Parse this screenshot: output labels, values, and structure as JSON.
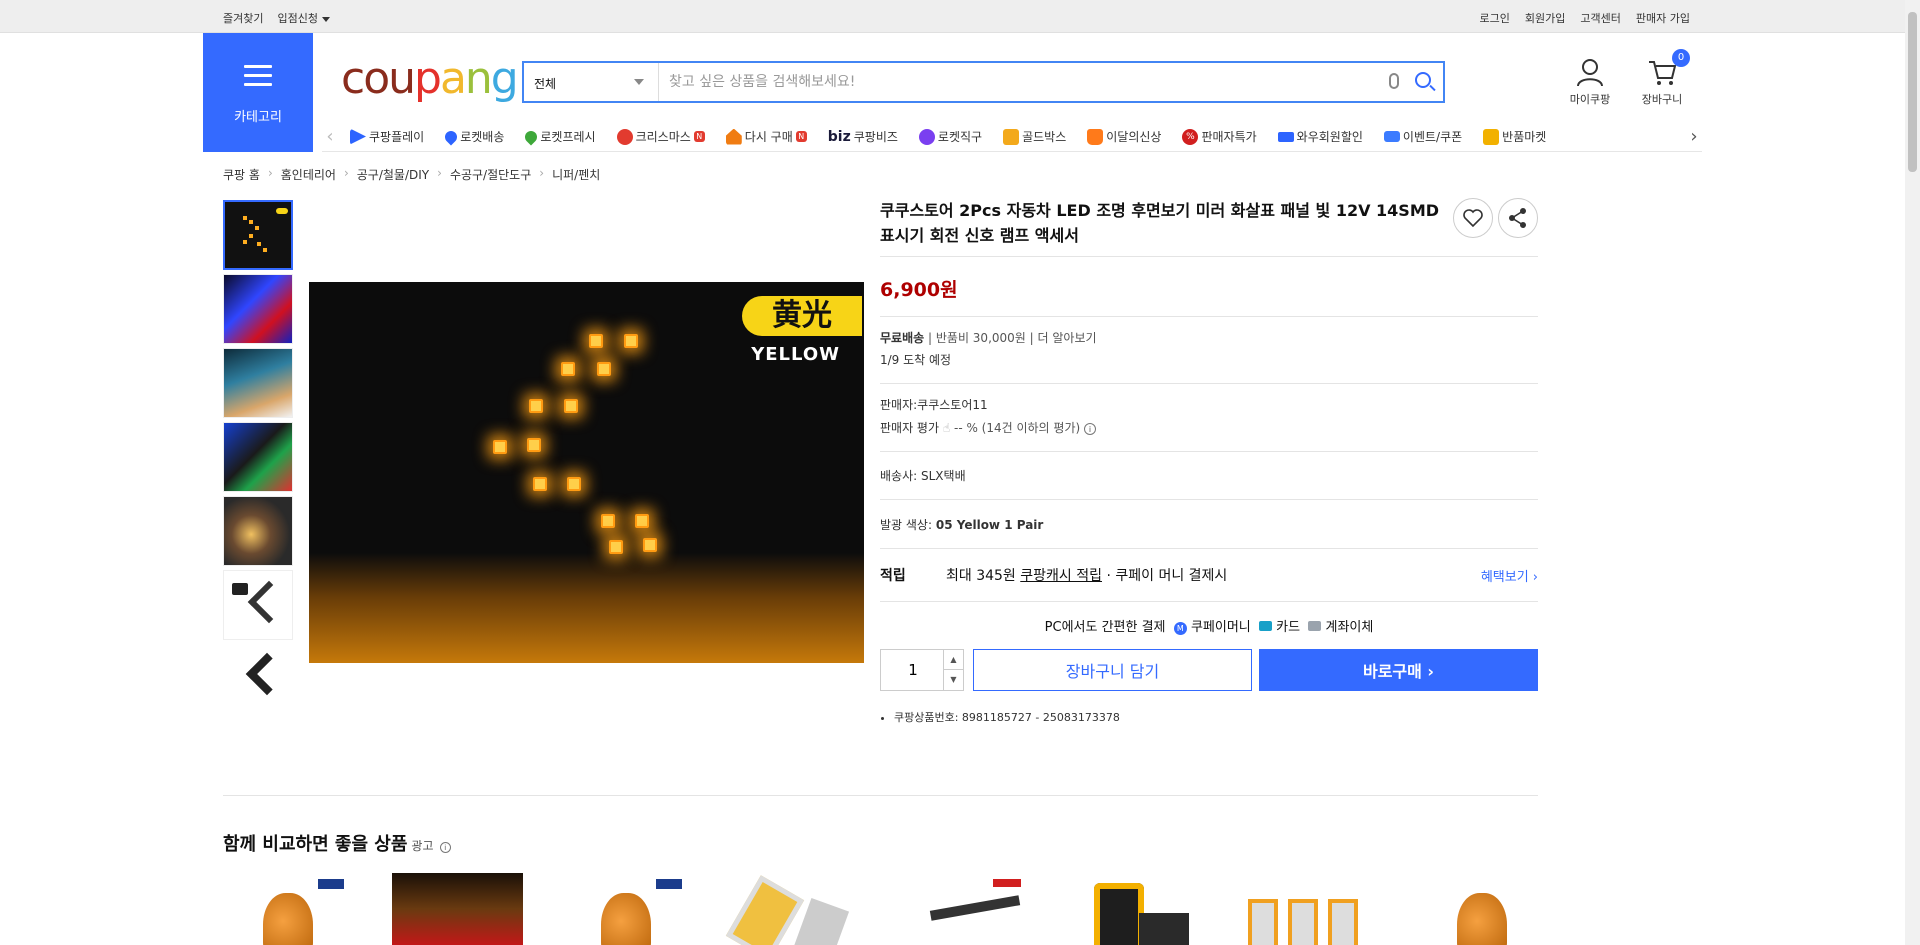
{
  "topbar": {
    "left": {
      "favorites": "즐겨찾기",
      "vendor_apply": "입점신청"
    },
    "right": [
      "로그인",
      "회원가입",
      "고객센터",
      "판매자 가입"
    ]
  },
  "header": {
    "category_label": "카테고리",
    "logo": {
      "c1": "cou",
      "c2": "p",
      "c3": "a",
      "c4": "n",
      "c5": "g"
    },
    "search": {
      "scope": "전체",
      "placeholder": "찾고 싶은 상품을 검색해보세요!"
    },
    "mycoupang": "마이쿠팡",
    "cart": "장바구니",
    "cart_count": "0"
  },
  "nav": {
    "items": [
      {
        "label": "쿠팡플레이",
        "icon": "play-icon",
        "color": "#2d64ff"
      },
      {
        "label": "로켓배송",
        "icon": "rocket-icon",
        "color": "#2d64ff"
      },
      {
        "label": "로켓프레시",
        "icon": "rocket-fresh-icon",
        "color": "#3ea83a"
      },
      {
        "label": "크리스마스",
        "icon": "santa-icon",
        "color": "#e23b2f"
      },
      {
        "label": "다시 구매",
        "icon": "home-icon",
        "color": "#f07c12"
      },
      {
        "label": "쿠팡비즈",
        "icon": "biz-icon",
        "color": "#1b1b3a",
        "prefix": "biz"
      },
      {
        "label": "로켓직구",
        "icon": "globe-icon",
        "color": "#7a3ff0"
      },
      {
        "label": "골드박스",
        "icon": "gift-icon",
        "color": "#f3a91b"
      },
      {
        "label": "이달의신상",
        "icon": "new-icon",
        "color": "#ff7a1a"
      },
      {
        "label": "판매자특가",
        "icon": "percent-icon",
        "color": "#d11f1f"
      },
      {
        "label": "와우회원할인",
        "icon": "wow-icon",
        "color": "#2d64ff"
      },
      {
        "label": "이벤트/쿠폰",
        "icon": "coupon-icon",
        "color": "#3b7bff"
      },
      {
        "label": "반품마켓",
        "icon": "market-icon",
        "color": "#f2b100"
      }
    ]
  },
  "breadcrumb": [
    "쿠팡 홈",
    "홈인테리어",
    "공구/철물/DIY",
    "수공구/절단도구",
    "니퍼/펜치"
  ],
  "product": {
    "title": "쿠쿠스토어 2Pcs 자동차 LED 조명 후면보기 미러 화살표 패널 빛 12V 14SMD 표시기 회전 신호 램프 액세서",
    "badge_cn": "黄光",
    "badge_en": "YELLOW",
    "price": "6,900원",
    "shipping": {
      "free": "무료배송",
      "return_fee": "반품비 30,000원",
      "more": "더 알아보기",
      "eta": "1/9 도착 예정"
    },
    "seller": {
      "label": "판매자:",
      "name": "쿠쿠스토어11",
      "rating_label": "판매자 평가",
      "rating_value": "-- % (14건 이하의 평가)"
    },
    "carrier": {
      "label": "배송사:",
      "name": "SLX택배"
    },
    "option": {
      "label": "발광 색상:",
      "value": "05 Yellow 1 Pair"
    },
    "reward": {
      "label": "적립",
      "max": "최대 345원",
      "cash": "쿠팡캐시 적립",
      "tail": "· 쿠페이 머니 결제시",
      "benefit": "혜택보기"
    },
    "pay": {
      "title": "PC에서도 간편한 결제",
      "money": "쿠페이머니",
      "card": "카드",
      "bank": "계좌이체"
    },
    "quantity": "1",
    "cart_button": "장바구니 담기",
    "buy_button": "바로구매",
    "product_no": "쿠팡상품번호: 8981185727 - 25083173378"
  },
  "compare": {
    "title": "함께 비교하면 좋을 상품",
    "ad": "광고"
  }
}
